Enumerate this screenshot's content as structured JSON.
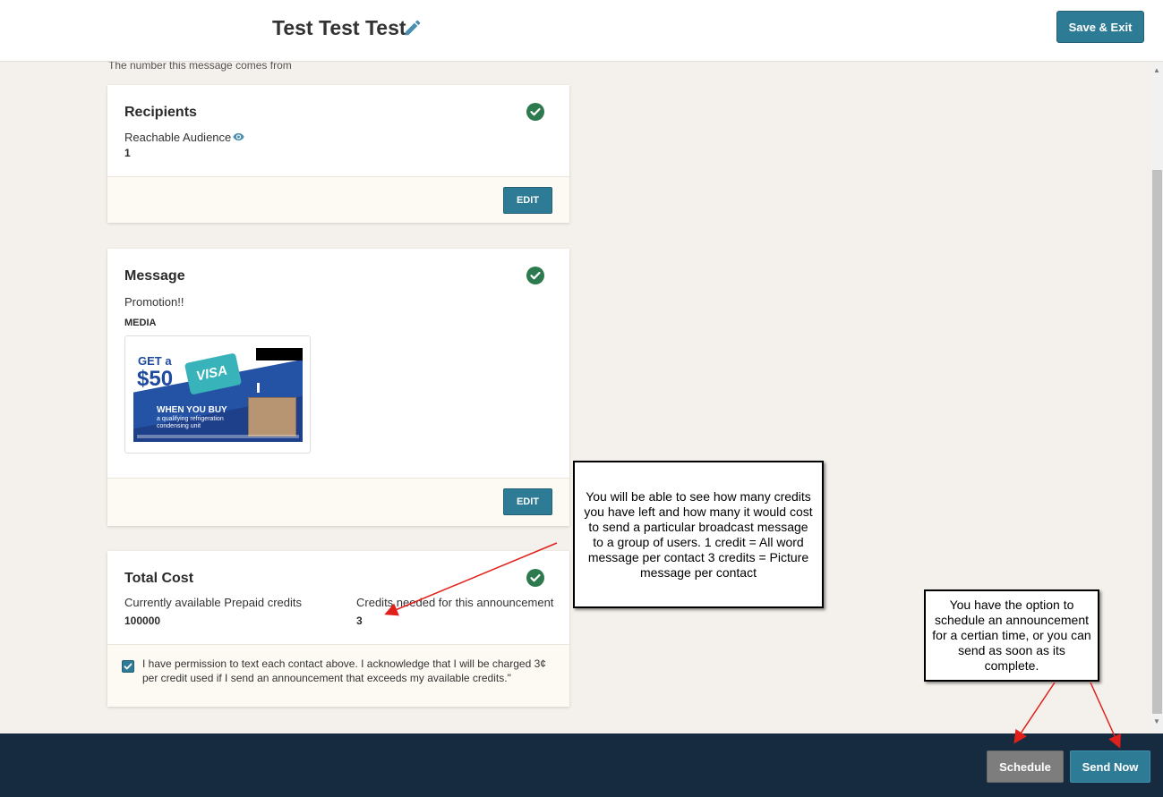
{
  "header": {
    "title": "Test Test Test",
    "save_exit_label": "Save & Exit"
  },
  "helper_text": "The number this message comes from",
  "recipients": {
    "title": "Recipients",
    "audience_label": "Reachable Audience",
    "audience_value": "1",
    "edit_label": "EDIT"
  },
  "message": {
    "title": "Message",
    "text": "Promotion!!",
    "media_label": "MEDIA",
    "edit_label": "EDIT",
    "media_image": {
      "get_text": "GET a",
      "amount": "$50",
      "card_brand": "VISA",
      "headline": "WHEN YOU BUY",
      "subline": "a qualifying refrigeration condensing unit"
    }
  },
  "total_cost": {
    "title": "Total Cost",
    "available_label": "Currently available Prepaid credits",
    "available_value": "100000",
    "needed_label": "Credits needed for this announcement",
    "needed_value": "3",
    "consent_text": "I have permission to text each contact above. I acknowledge that I will be charged 3¢ per credit used if I send an announcement that exceeds my available credits.\"",
    "consent_checked": true
  },
  "footer": {
    "schedule_label": "Schedule",
    "send_now_label": "Send Now"
  },
  "annotations": {
    "credits_note": "You will be able to see how many credits you have left and how many it would cost to send a particular broadcast message to a group of users. 1 credit = All word message  per contact  3 credits = Picture message per contact",
    "schedule_note": "You have the option to schedule an announcement for a certian time, or you can send as soon as its complete."
  },
  "colors": {
    "primary_button": "#2e7b96",
    "secondary_button": "#7d7d7d",
    "check_green": "#2d7a4f",
    "footer_bg": "#162a40",
    "page_bg": "#f4f0eb",
    "arrow_red": "#e0201b"
  },
  "icons": {
    "title_edit": "pencil-icon",
    "audience_view": "eye-icon",
    "section_complete": "check-circle-icon",
    "consent": "checkbox-checked-icon"
  }
}
